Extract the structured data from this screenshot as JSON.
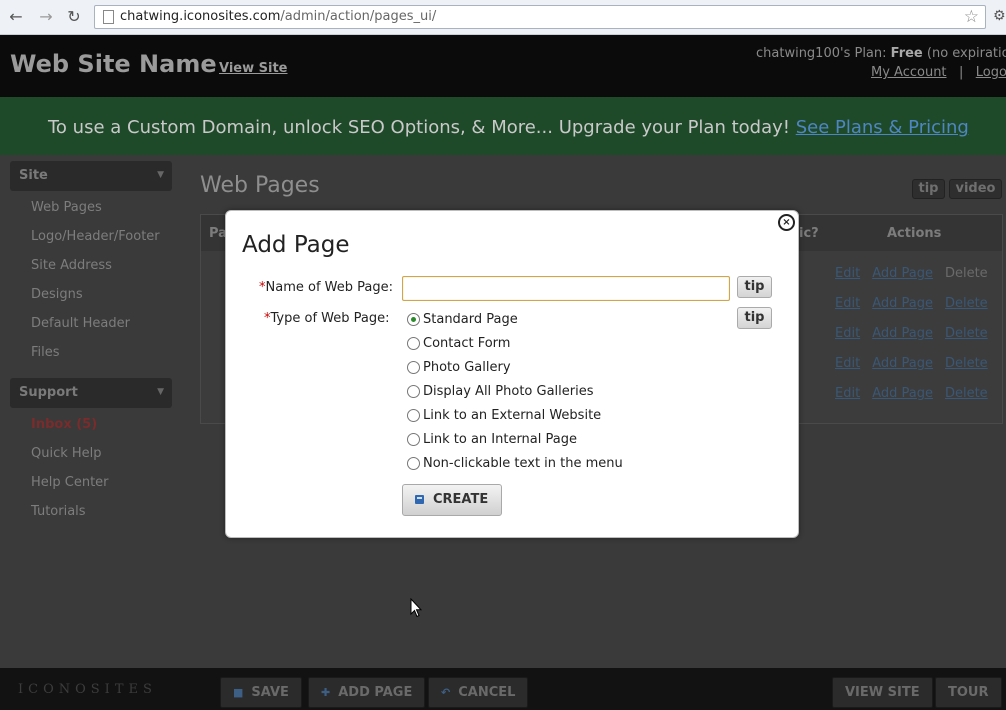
{
  "browser": {
    "url_host": "chatwing.iconosites.com",
    "url_path": "/admin/action/pages_ui/"
  },
  "header": {
    "site_name": "Web Site Name",
    "view_site": "View Site",
    "plan_prefix": "chatwing100's Plan:",
    "plan_name": "Free",
    "plan_suffix": "(no expiration)",
    "my_account": "My Account",
    "separator": "|",
    "logout": "Logout"
  },
  "upgrade": {
    "message": "To use a Custom Domain, unlock SEO Options, & More... Upgrade your Plan today!",
    "link": "See Plans & Pricing"
  },
  "sidebar": {
    "site_header": "Site",
    "site_items": [
      "Web Pages",
      "Logo/Header/Footer",
      "Site Address",
      "Designs",
      "Default Header",
      "Files"
    ],
    "support_header": "Support",
    "support_items": [
      "Inbox (5)",
      "Quick Help",
      "Help Center",
      "Tutorials"
    ]
  },
  "main": {
    "heading": "Web Pages",
    "tip": "tip",
    "video": "video",
    "col_first": "Pa",
    "col_public": "ic?",
    "col_actions": "Actions",
    "row_edit": "Edit",
    "row_add_page": "Add Page",
    "row_delete": "Delete"
  },
  "modal": {
    "title": "Add Page",
    "close": "×",
    "name_label": "Name of Web Page:",
    "type_label": "Type of Web Page:",
    "required_mark": "*",
    "name_value": "",
    "tip": "tip",
    "options": [
      "Standard Page",
      "Contact Form",
      "Photo Gallery",
      "Display All Photo Galleries",
      "Link to an External Website",
      "Link to an Internal Page",
      "Non-clickable text in the menu"
    ],
    "selected_option": "Standard Page",
    "create": "CREATE"
  },
  "footer": {
    "logo": "ICONOSITES",
    "save": "SAVE",
    "add_page": "ADD PAGE",
    "cancel": "CANCEL",
    "view_site": "VIEW SITE",
    "tour": "TOUR"
  }
}
